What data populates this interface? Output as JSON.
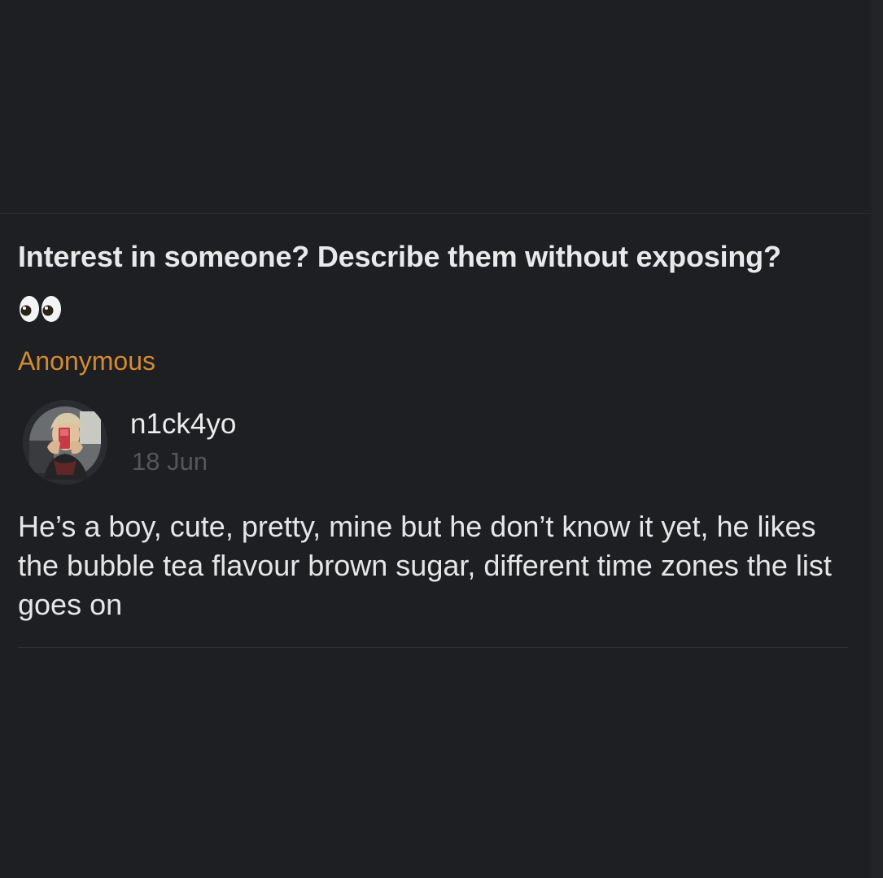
{
  "question": {
    "text": "Interest in someone? Describe them without exposing?",
    "emoji_icon": "eyes-emoji-icon",
    "asker": "Anonymous"
  },
  "answer": {
    "username": "n1ck4yo",
    "date": "18 Jun",
    "avatar_icon": "user-photo-avatar",
    "text": "He’s a boy, cute, pretty, mine but he don’t know it yet, he likes the bubble tea flavour brown sugar, different time zones the list goes on"
  },
  "colors": {
    "background": "#1e1f23",
    "asker_accent": "#d48a33",
    "date_muted": "#55565b"
  }
}
